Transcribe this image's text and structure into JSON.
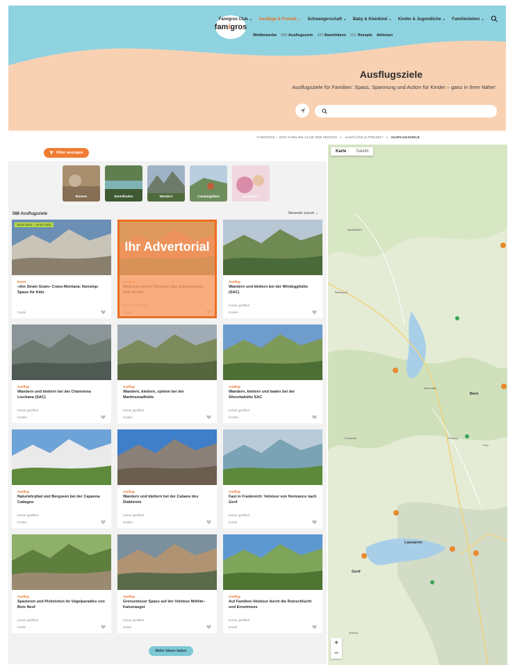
{
  "header": {
    "logo_text_a": "fam",
    "logo_text_b": "i",
    "logo_text_c": "gros",
    "nav": [
      {
        "label": "Famigros Club ⌄",
        "active": false
      },
      {
        "label": "Ausflüge & Freizeit ⌄",
        "active": true
      },
      {
        "label": "Schwangerschaft ⌄",
        "active": false
      },
      {
        "label": "Baby & Kleinkind ⌄",
        "active": false
      },
      {
        "label": "Kinder & Jugendliche ⌄",
        "active": false
      },
      {
        "label": "Familienleben ⌄",
        "active": false
      }
    ],
    "subnav": [
      {
        "num": "",
        "label": "Wettbewerbe"
      },
      {
        "num": "589",
        "label": "Ausflugsziele"
      },
      {
        "num": "383",
        "label": "Bastelideen"
      },
      {
        "num": "201",
        "label": "Rezepte"
      },
      {
        "num": "",
        "label": "Aktionen"
      }
    ]
  },
  "hero": {
    "title": "Ausflugsziele",
    "subtitle": "Ausflugsziele für Familien: Spass, Spannung und Action für Kinder – ganz in Ihrer Nähe!",
    "search_placeholder": ""
  },
  "breadcrumb": {
    "items": [
      "FAMIGROS – DER FAMILIEN-CLUB DER MIGROS",
      "AUSFLÜGE & FREIZEIT"
    ],
    "current": "AUSFLUGSZIELE"
  },
  "filter": {
    "button_label": "Filter anzeigen"
  },
  "categories": [
    {
      "label": "Museen",
      "color": "#a98e6e"
    },
    {
      "label": "Bastelbuden",
      "color": "#5f7f4f"
    },
    {
      "label": "Wandern",
      "color": "#7d8a96"
    },
    {
      "label": "Campingplätze",
      "color": "#6e8d5c"
    },
    {
      "label": "Spielplätze",
      "color": "#d98ca8"
    }
  ],
  "list": {
    "count": "588 Ausflugsziele",
    "sort": "Neueste zuerst ⌄",
    "more_button": "Mehr Ideen laden"
  },
  "cards": [
    {
      "kind": "Event",
      "title": "«Am Stram Gram» Crans-Montana: Nonstop-Spass für Kids",
      "date": "",
      "price": "Gratis",
      "badge": "16.07.2021 – 18.07.2021",
      "c1": "#6b8fb5",
      "c2": "#c9c4b8",
      "c3": "#8a7f6c",
      "ad": false
    },
    {
      "kind": "Ausflug",
      "title": "Madrisa-Land in Klosters, das Spielparadies aller Kinder",
      "date": "Heute 09:00-18:00",
      "price": "Kosten",
      "badge": "",
      "c1": "#7a9b52",
      "c2": "#c47c4c",
      "c3": "#5c7a3e",
      "ad": true,
      "ad_label": "Ihr Advertorial"
    },
    {
      "kind": "Ausflug",
      "title": "Wandern und klettern bei der Windegghütte (SAC)",
      "date": "Immer geöffnet",
      "price": "Kosten",
      "badge": "",
      "c1": "#b8c7d4",
      "c2": "#6f8a52",
      "c3": "#4a6a3a",
      "ad": false
    },
    {
      "kind": "Ausflug",
      "title": "Wandern und klettern bei der Chamonna Lischana (SAC)",
      "date": "Immer geöffnet",
      "price": "Kosten",
      "badge": "",
      "c1": "#8b9496",
      "c2": "#6d7a72",
      "c3": "#4f5a55",
      "ad": false
    },
    {
      "kind": "Ausflug",
      "title": "Wandern, klettern, spielen bei der Martinsmadhütte",
      "date": "Immer geöffnet",
      "price": "Kosten",
      "badge": "",
      "c1": "#a0acb5",
      "c2": "#7d8b5c",
      "c3": "#56663e",
      "ad": false
    },
    {
      "kind": "Ausflug",
      "title": "Wandern, klettern und baden bei der Silvrettahütte SAC",
      "date": "Immer geöffnet",
      "price": "Kosten",
      "badge": "",
      "c1": "#6e9ccc",
      "c2": "#7e9a58",
      "c3": "#4d6e35",
      "ad": false
    },
    {
      "kind": "Ausflug",
      "title": "Naturlehrpfad und Bergseen bei der Capanna Cadagno",
      "date": "Immer geöffnet",
      "price": "Kosten",
      "badge": "",
      "c1": "#6ea3d8",
      "c2": "#eaeaea",
      "c3": "#5e8a3c",
      "ad": false
    },
    {
      "kind": "Ausflug",
      "title": "Wandern und klettern bei der Cabane des Diablerets",
      "date": "Immer geöffnet",
      "price": "Kosten",
      "badge": "",
      "c1": "#3f7ec9",
      "c2": "#8b8077",
      "c3": "#6b5e4f",
      "ad": false
    },
    {
      "kind": "Ausflug",
      "title": "Fast in Frankreich: Velotour von Hermance nach Genf",
      "date": "Immer geöffnet",
      "price": "Gratis",
      "badge": "",
      "c1": "#b9cbd8",
      "c2": "#7aa3b5",
      "c3": "#5c8a3a",
      "ad": false
    },
    {
      "kind": "Ausflug",
      "title": "Spazieren und Picknicken im Vogelparadies von Bois Neuf",
      "date": "Immer geöffnet",
      "price": "Gratis",
      "badge": "",
      "c1": "#8fb068",
      "c2": "#5e7f3e",
      "c3": "#9a8a70",
      "ad": false
    },
    {
      "kind": "Ausflug",
      "title": "Grenzenloser Spass auf der Velotour Möhlin–Kaiseraugst",
      "date": "Immer geöffnet",
      "price": "Gratis",
      "badge": "",
      "c1": "#7c8f9c",
      "c2": "#b09372",
      "c3": "#5b6a4a",
      "ad": false
    },
    {
      "kind": "Ausflug",
      "title": "Auf Familien-Velotour durch die Rotzschlucht und Ennetmoos",
      "date": "Immer geöffnet",
      "price": "Gratis",
      "badge": "",
      "c1": "#5e98d0",
      "c2": "#7fa55a",
      "c3": "#4f7533",
      "ad": false
    }
  ],
  "map": {
    "toggle_map": "Karte",
    "toggle_sat": "Satellit",
    "zoom_in": "+",
    "zoom_out": "−",
    "places": [
      {
        "name": "Bern",
        "big": true
      },
      {
        "name": "Lausanne",
        "big": true
      },
      {
        "name": "Genf",
        "big": true
      },
      {
        "name": "Neuchâtel",
        "big": false
      },
      {
        "name": "Fribourg",
        "big": false
      },
      {
        "name": "Montbéliard",
        "big": false
      },
      {
        "name": "Besançon",
        "big": false
      },
      {
        "name": "Pontarlier",
        "big": false
      },
      {
        "name": "Annecy",
        "big": false
      },
      {
        "name": "Thun",
        "big": false
      }
    ]
  },
  "colors": {
    "accent": "#e86c1f",
    "hero_blue": "#8fd3e0",
    "hero_peach": "#f8d1b3",
    "button_teal": "#7cc8d6"
  }
}
